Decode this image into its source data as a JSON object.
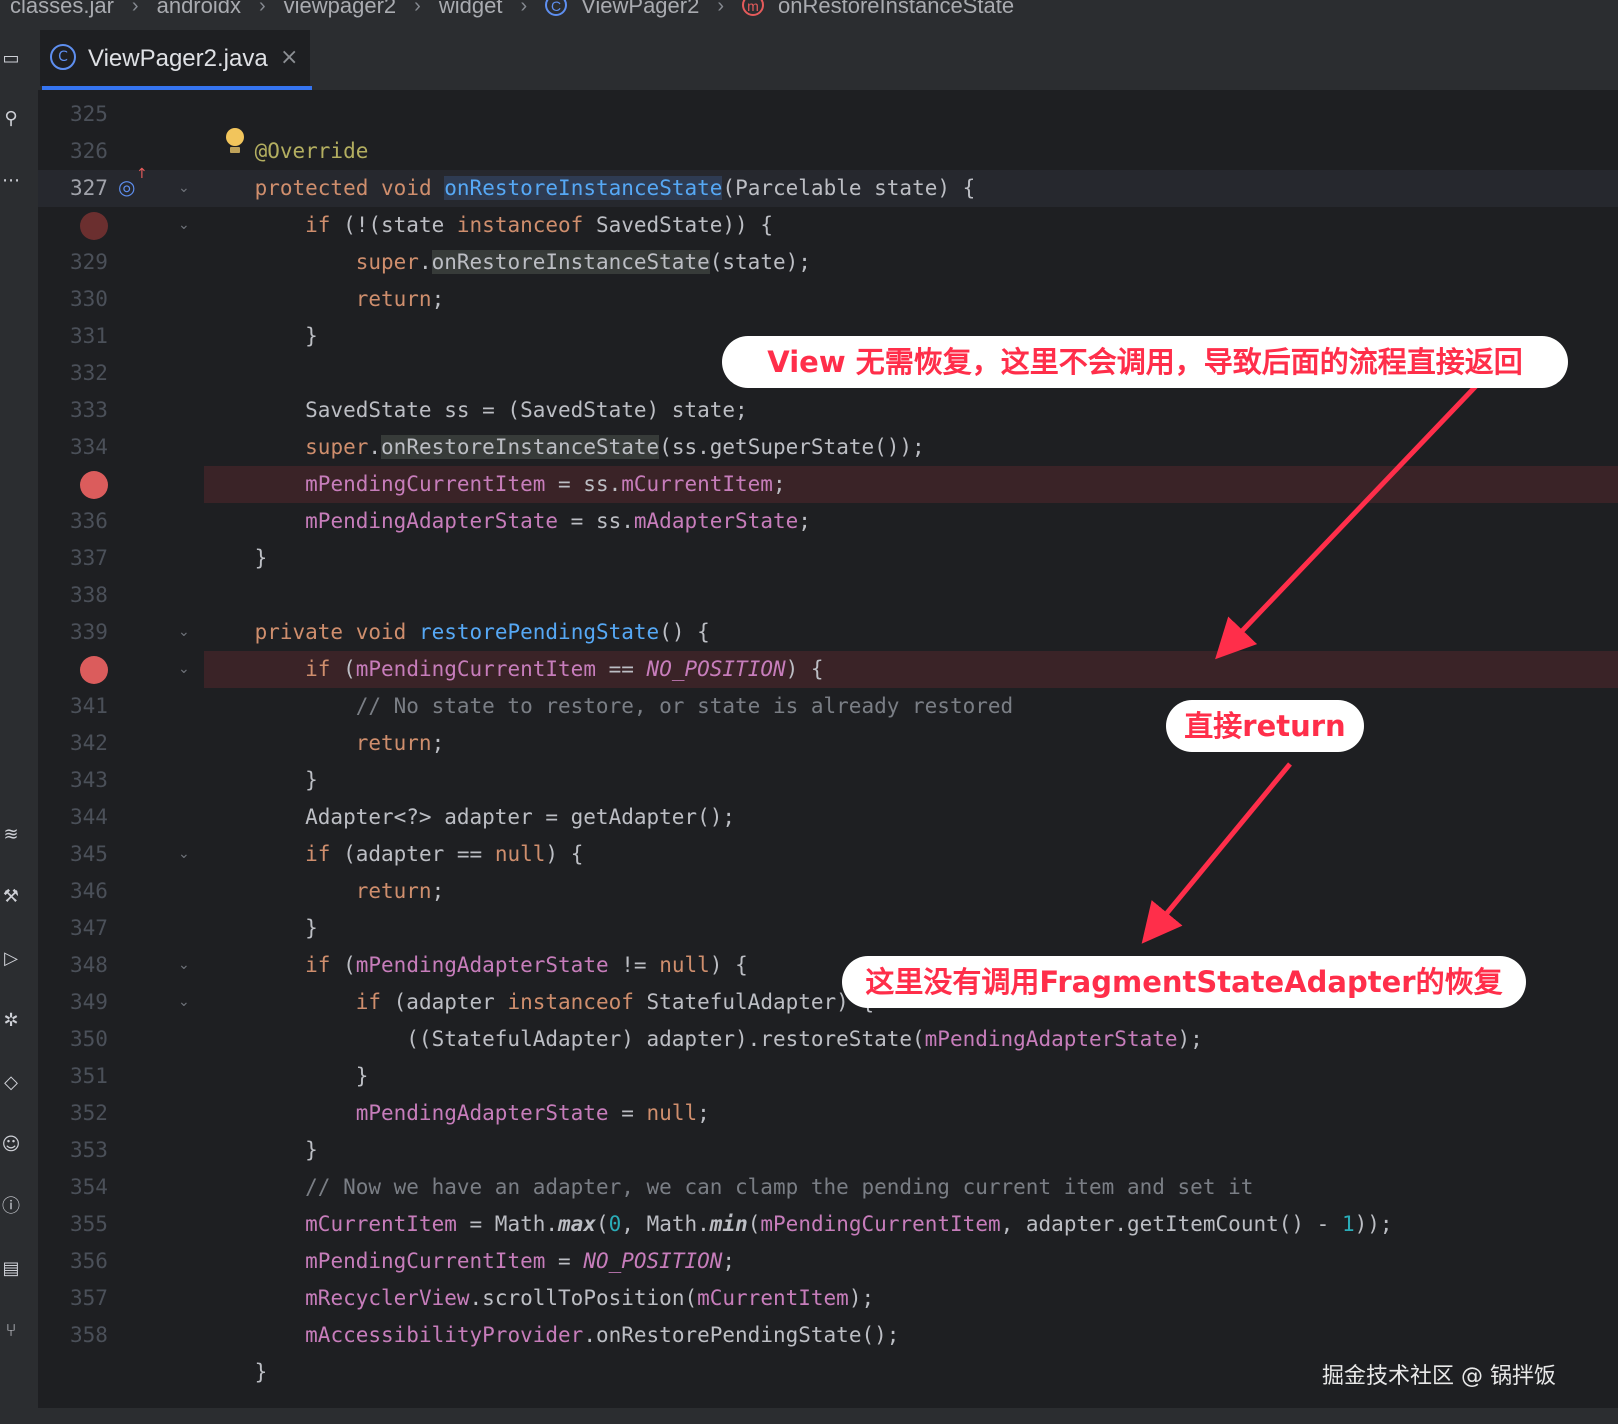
{
  "breadcrumb": [
    "classes.jar",
    "androidx",
    "viewpager2",
    "widget",
    "ViewPager2",
    "onRestoreInstanceState"
  ],
  "tab": {
    "label": "ViewPager2.java",
    "close": "×"
  },
  "lines": [
    "325",
    "326",
    "327",
    "",
    "329",
    "330",
    "331",
    "332",
    "333",
    "334",
    "",
    "336",
    "337",
    "338",
    "339",
    "",
    "341",
    "342",
    "343",
    "344",
    "345",
    "346",
    "347",
    "348",
    "349",
    "350",
    "351",
    "352",
    "353",
    "354",
    "355",
    "356",
    "357",
    "358"
  ],
  "annotations": {
    "a1": "View 无需恢复，这里不会调用，导致后面的流程直接返回",
    "a2": "直接return",
    "a3": "这里没有调用FragmentStateAdapter的恢复"
  },
  "watermark": "掘金技术社区 @ 锅拌饭",
  "colors": {
    "accent": "#3574f0",
    "breakpoint": "#db5c5c",
    "annotation_text": "#ff2e4a",
    "highlight_row": "#3a2327"
  }
}
